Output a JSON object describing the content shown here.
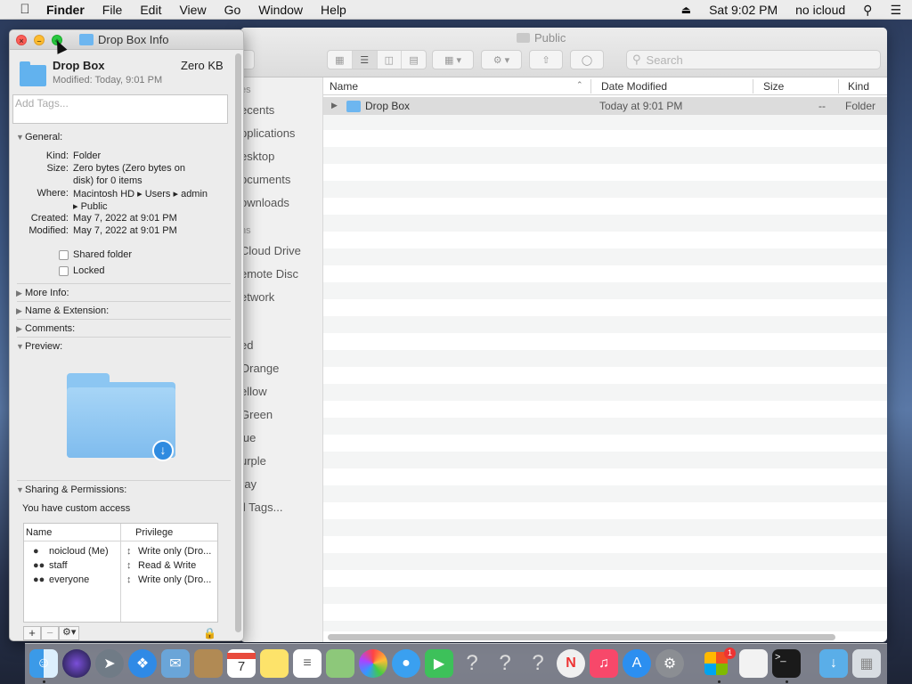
{
  "menubar": {
    "apple_icon": "apple-icon",
    "items": [
      "Finder",
      "File",
      "Edit",
      "View",
      "Go",
      "Window",
      "Help"
    ],
    "clock": "Sat 9:02 PM",
    "user": "no icloud"
  },
  "finder_window": {
    "title": "Public",
    "search_placeholder": "Search",
    "sidebar_items": [
      "es",
      "ecents",
      "pplications",
      "esktop",
      "ocuments",
      "ownloads",
      "ns",
      "Cloud Drive",
      "emote Disc",
      "etwork",
      "ed",
      "Orange",
      "ellow",
      "Green",
      "lue",
      "urple",
      "ray",
      "ll Tags..."
    ],
    "columns": [
      "Name",
      "Date Modified",
      "Size",
      "Kind"
    ],
    "rows": [
      {
        "name": "Drop Box",
        "date": "Today at 9:01 PM",
        "size": "--",
        "kind": "Folder"
      }
    ]
  },
  "info_window": {
    "title": "Drop Box Info",
    "name": "Drop Box",
    "size_short": "Zero KB",
    "modified_short": "Modified: Today, 9:01 PM",
    "tags_placeholder": "Add Tags...",
    "general_header": "General:",
    "kind_label": "Kind:",
    "kind_value": "Folder",
    "size_label": "Size:",
    "size_value_1": "Zero bytes (Zero bytes on",
    "size_value_2": "disk) for 0 items",
    "where_label": "Where:",
    "where_value_1": "Macintosh HD ▸ Users ▸ admin",
    "where_value_2": "▸ Public",
    "created_label": "Created:",
    "created_value": "May 7, 2022 at 9:01 PM",
    "modified_label": "Modified:",
    "modified_value": "May 7, 2022 at 9:01 PM",
    "shared_folder": "Shared folder",
    "locked": "Locked",
    "more_info": "More Info:",
    "name_ext": "Name & Extension:",
    "comments": "Comments:",
    "preview": "Preview:",
    "sharing": "Sharing & Permissions:",
    "custom_access": "You have custom access",
    "perm_col_name": "Name",
    "perm_col_priv": "Privilege",
    "permissions": [
      {
        "name": "noicloud (Me)",
        "privilege": "Write only (Dro..."
      },
      {
        "name": "staff",
        "privilege": "Read & Write"
      },
      {
        "name": "everyone",
        "privilege": "Write only (Dro..."
      }
    ],
    "add_button": "+",
    "remove_button": "−",
    "gear_button": "⚙▾"
  },
  "dock": {
    "icons": [
      "finder-icon",
      "siri-icon",
      "launchpad-icon",
      "safari-icon",
      "mail-icon",
      "contacts-icon",
      "calendar-icon",
      "notes-icon",
      "reminders-icon",
      "maps-icon",
      "photos-icon",
      "messages-icon",
      "facetime-icon",
      "unknown-icon",
      "unknown-icon",
      "unknown-icon",
      "news-icon",
      "music-icon",
      "app-store-icon",
      "system-preferences-icon",
      "microsoft-office-icon",
      "textedit-icon",
      "terminal-icon",
      "downloads-folder-icon",
      "trash-icon"
    ],
    "calendar_day": "7",
    "office_badge": "1"
  }
}
